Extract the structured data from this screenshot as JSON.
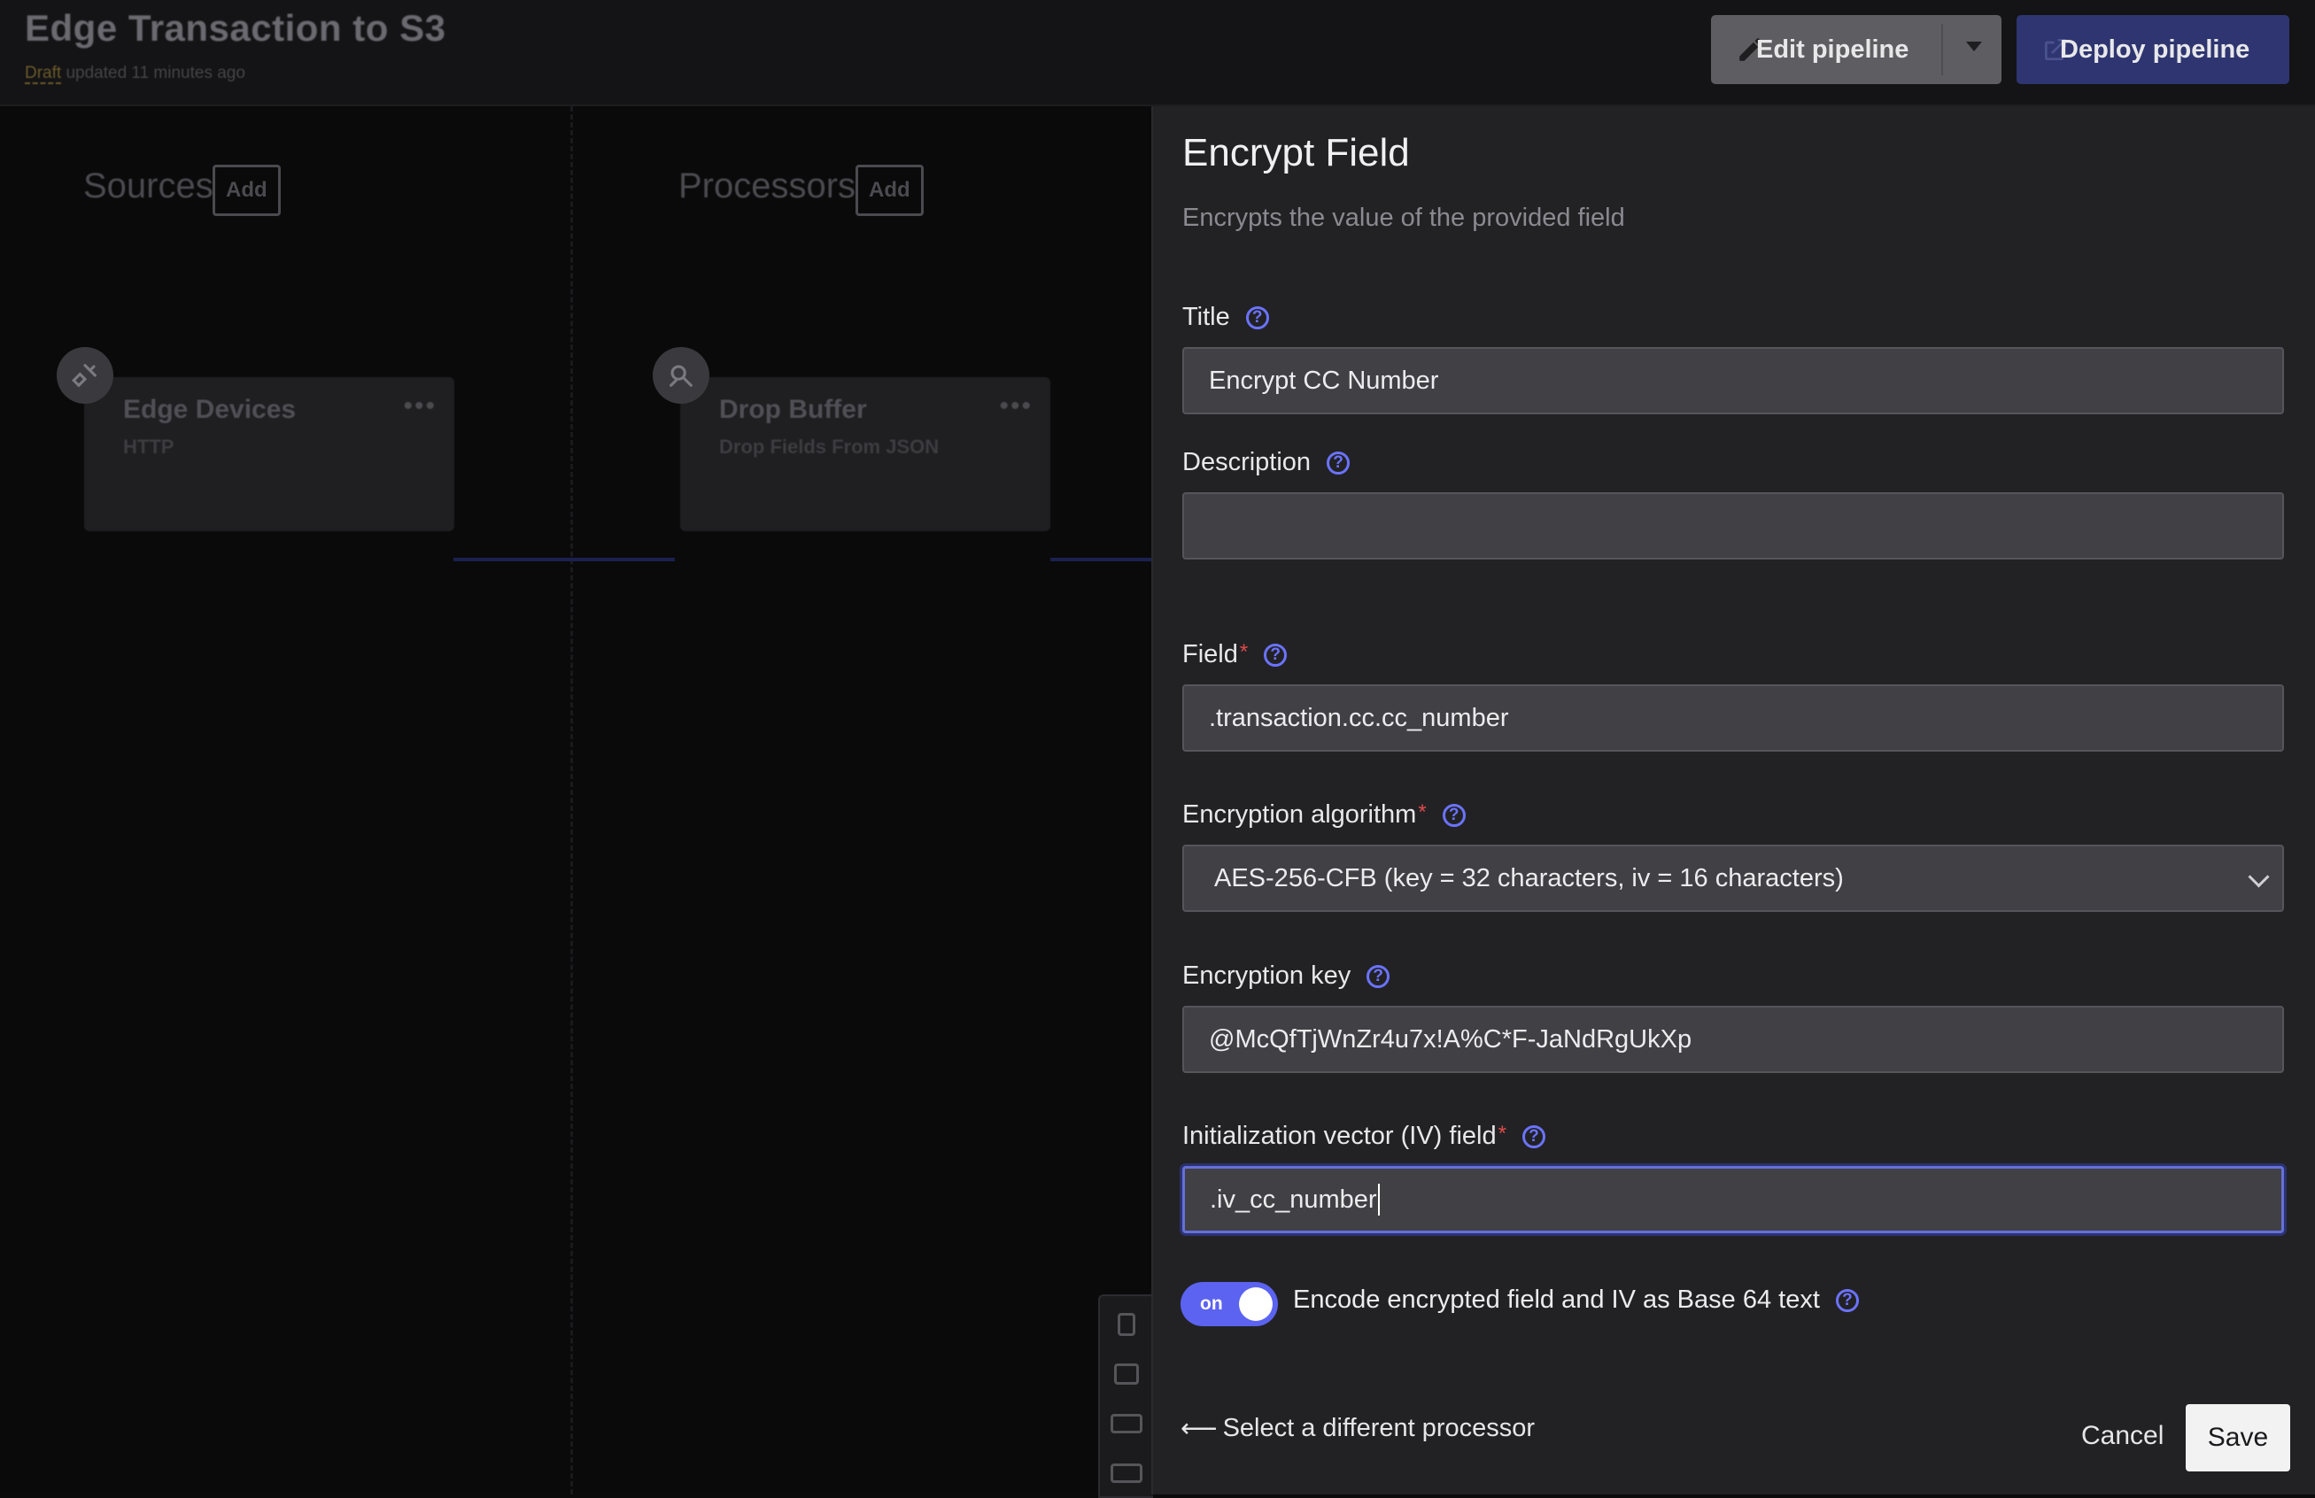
{
  "header": {
    "title": "Edge Transaction to S3",
    "status_badge": "Draft",
    "updated_text": "updated 11 minutes ago",
    "edit_button": "Edit pipeline",
    "deploy_button": "Deploy pipeline"
  },
  "canvas": {
    "sources": {
      "title": "Sources",
      "add_label": "Add"
    },
    "processors": {
      "title": "Processors",
      "add_label": "Add"
    },
    "nodes": [
      {
        "title": "Edge Devices",
        "subtitle": "HTTP",
        "menu": "•••",
        "icon": "plug-icon"
      },
      {
        "title": "Drop Buffer",
        "subtitle": "Drop Fields From JSON",
        "menu": "•••",
        "icon": "processor-icon"
      }
    ]
  },
  "panel": {
    "title": "Encrypt Field",
    "description": "Encrypts the value of the provided field",
    "help_glyph": "?",
    "required_mark": "*",
    "fields": {
      "title": {
        "label": "Title",
        "value": "Encrypt CC Number"
      },
      "description": {
        "label": "Description",
        "value": ""
      },
      "field": {
        "label": "Field",
        "value": ".transaction.cc.cc_number"
      },
      "algorithm": {
        "label": "Encryption algorithm",
        "value": "AES-256-CFB (key = 32 characters, iv = 16 characters)"
      },
      "key": {
        "label": "Encryption key",
        "value": "@McQfTjWnZr4u7x!A%C*F-JaNdRgUkXp"
      },
      "iv": {
        "label": "Initialization vector (IV) field",
        "value": ".iv_cc_number"
      }
    },
    "toggle": {
      "state": "on",
      "label": "Encode encrypted field and IV as Base 64 text"
    },
    "back_link": "Select a different processor",
    "back_arrow": "⟵",
    "cancel": "Cancel",
    "save": "Save"
  },
  "colors": {
    "accent": "#5b63f0",
    "help_icon": "#6b73ff",
    "required": "#e04a4a",
    "panel_bg": "#222225"
  }
}
